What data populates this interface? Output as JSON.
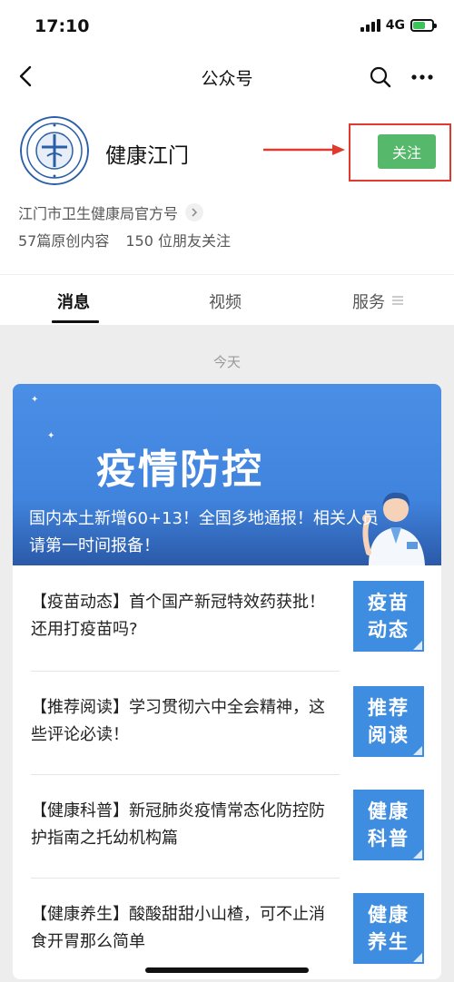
{
  "status_bar": {
    "time": "17:10",
    "network": "4G"
  },
  "nav": {
    "title": "公众号",
    "back_icon": "back-arrow-icon",
    "search_icon": "search-icon",
    "more_icon": "more-dots-icon"
  },
  "account": {
    "name": "健康江门",
    "follow_label": "关注",
    "description": "江门市卫生健康局官方号",
    "original_count": "57篇原创内容",
    "friends_following": "150 位朋友关注",
    "highlight_color": "#e03a2f",
    "follow_color": "#55b86b"
  },
  "tabs": [
    {
      "label": "消息"
    },
    {
      "label": "视频"
    },
    {
      "label": "服务"
    }
  ],
  "feed": {
    "date_label": "今天",
    "banner": {
      "heading": "疫情防控",
      "caption": "国内本土新增60+13！全国多地通报！相关人员请第一时间报备！"
    },
    "articles": [
      {
        "title": "【疫苗动态】首个国产新冠特效药获批！还用打疫苗吗?",
        "thumb": "疫苗动态"
      },
      {
        "title": "【推荐阅读】学习贯彻六中全会精神，这些评论必读！",
        "thumb": "推荐阅读"
      },
      {
        "title": "【健康科普】新冠肺炎疫情常态化防控防护指南之托幼机构篇",
        "thumb": "健康科普"
      },
      {
        "title": "【健康养生】酸酸甜甜小山楂，可不止消食开胃那么简单",
        "thumb": "健康养生"
      }
    ],
    "thumb_color": "#3f8de0",
    "banner_color": "#4a8ee6"
  }
}
